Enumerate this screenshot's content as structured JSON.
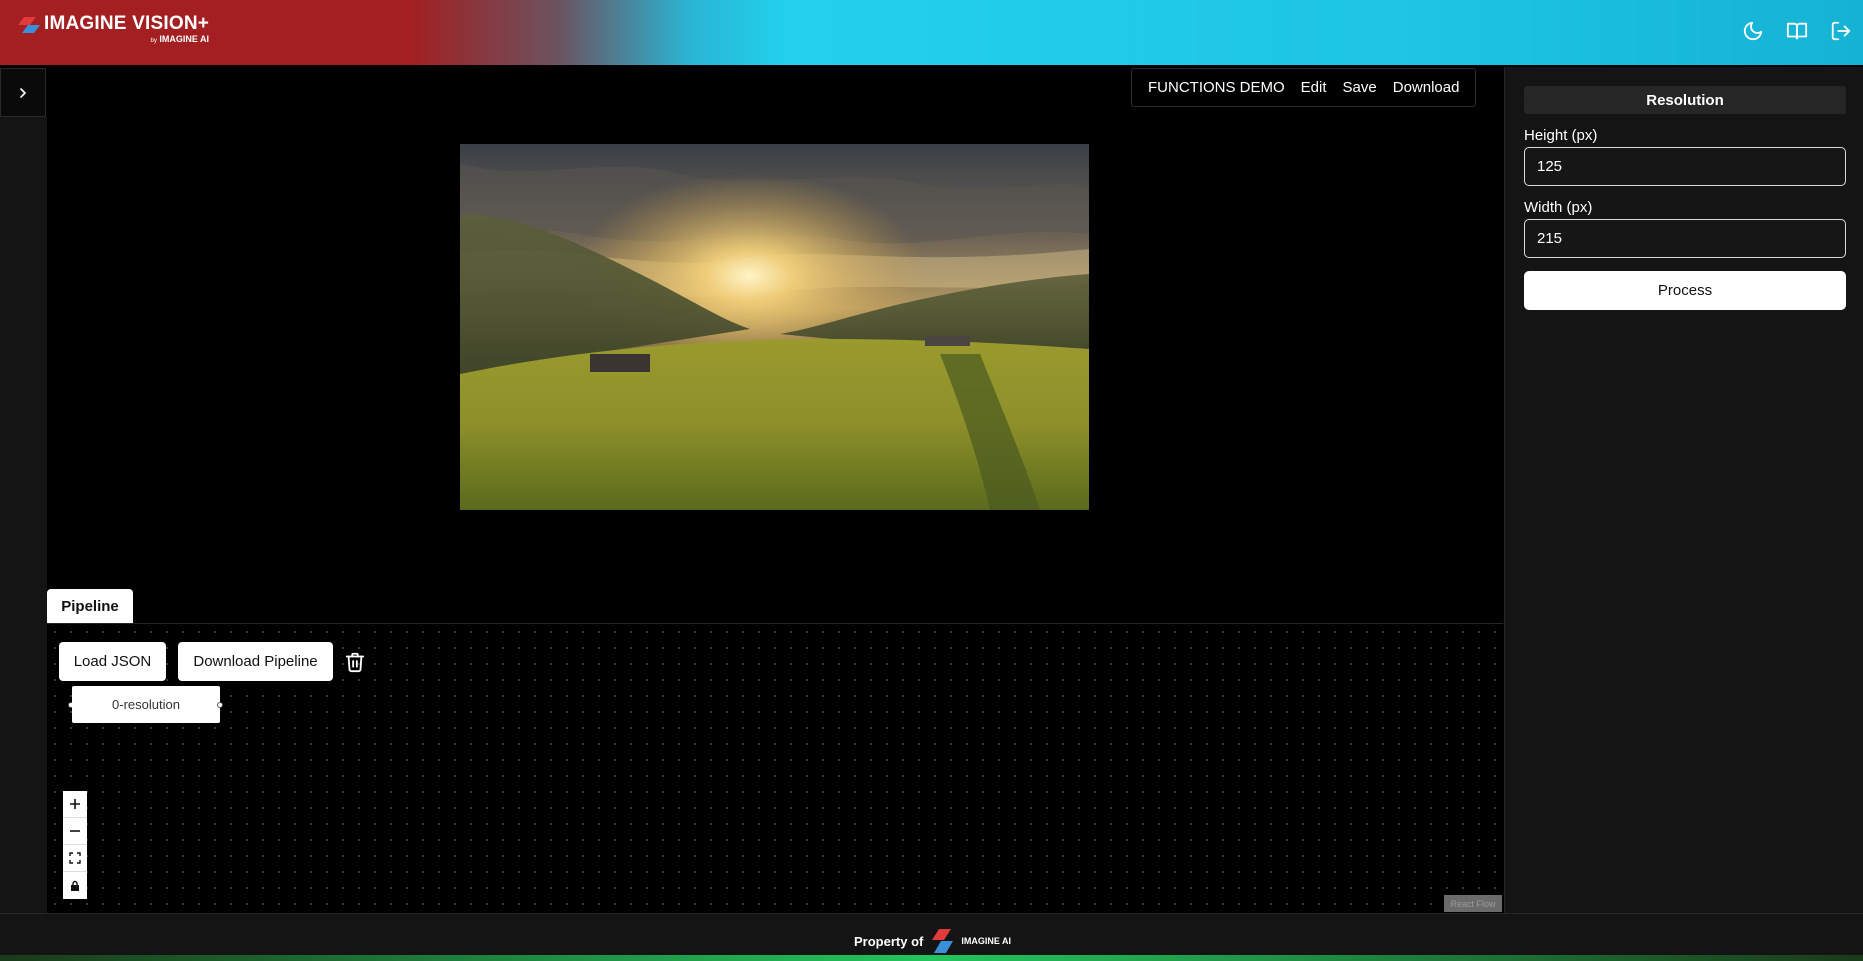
{
  "header": {
    "logo_title": "IMAGINE VISION+",
    "logo_by": "by",
    "logo_company": "IMAGINE AI",
    "icons": [
      "moon-icon",
      "book-icon",
      "logout-icon"
    ],
    "colors": {
      "left": "#a31f22",
      "right": "#1ec5e4"
    }
  },
  "topmenu": {
    "items": [
      "FUNCTIONS DEMO",
      "Edit",
      "Save",
      "Download"
    ]
  },
  "panel": {
    "section_title": "Resolution",
    "height_label": "Height (px)",
    "height_value": "125",
    "width_label": "Width (px)",
    "width_value": "215",
    "process_label": "Process"
  },
  "pipeline": {
    "tab_label": "Pipeline",
    "load_json_label": "Load JSON",
    "download_pipeline_label": "Download Pipeline",
    "node_label": "0-resolution",
    "attribution": "React Flow"
  },
  "footer": {
    "property_of": "Property of",
    "logo_text": "IMAGINE AI"
  }
}
